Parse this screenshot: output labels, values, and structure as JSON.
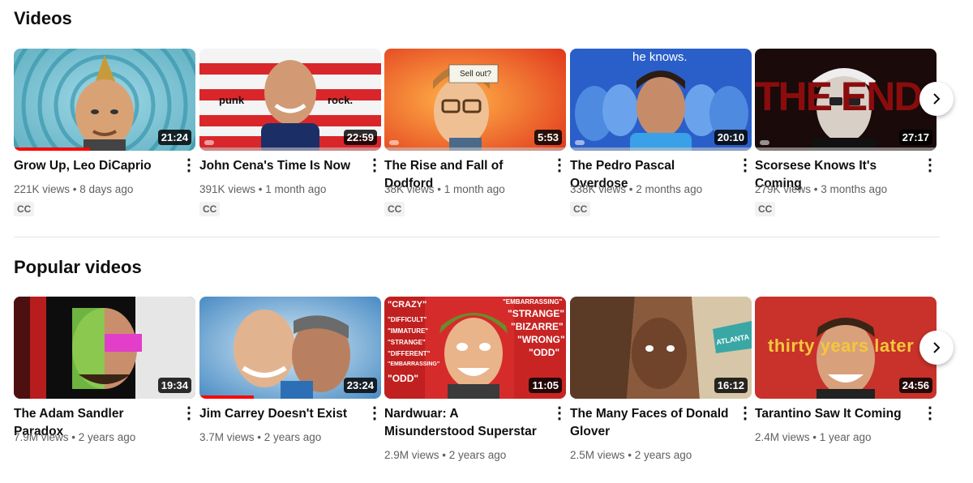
{
  "sections": [
    {
      "title": "Videos",
      "videos": [
        {
          "title": "Grow Up, Leo DiCaprio",
          "duration": "21:24",
          "views": "221K views",
          "age": "8 days ago",
          "cc": "CC",
          "progress": 0.42
        },
        {
          "title": "John Cena's Time Is Now",
          "duration": "22:59",
          "views": "391K views",
          "age": "1 month ago",
          "cc": "CC",
          "thumb_left_text": "punk",
          "thumb_right_text": "rock."
        },
        {
          "title": "The Rise and Fall of Dodford",
          "duration": "5:53",
          "views": "38K views",
          "age": "1 month ago",
          "cc": "CC",
          "thumb_text": "Sell out?"
        },
        {
          "title": "The Pedro Pascal Overdose",
          "duration": "20:10",
          "views": "338K views",
          "age": "2 months ago",
          "cc": "CC",
          "thumb_text": "he knows."
        },
        {
          "title": "Scorsese Knows It's Coming",
          "duration": "27:17",
          "views": "279K views",
          "age": "3 months ago",
          "cc": "CC",
          "thumb_text": "THE END"
        }
      ]
    },
    {
      "title": "Popular videos",
      "videos": [
        {
          "title": "The Adam Sandler Paradox",
          "duration": "19:34",
          "views": "7.9M views",
          "age": "2 years ago"
        },
        {
          "title": "Jim Carrey Doesn't Exist",
          "duration": "23:24",
          "views": "3.7M views",
          "age": "2 years ago",
          "progress": 0.3
        },
        {
          "title": "Nardwuar: A Misunderstood Superstar",
          "duration": "11:05",
          "views": "2.9M views",
          "age": "2 years ago",
          "thumb_words": [
            "\"CRAZY\"",
            "\"EMBARRASSING\"",
            "\"STRANGE\"",
            "\"BIZARRE\"",
            "\"WRONG\"",
            "\"ODD\"",
            "\"DIFFICULT\"",
            "\"IMMATURE\"",
            "\"STRANGE\"",
            "\"DIFFERENT\"",
            "\"EMBARRASSING\"",
            "\"ODD\""
          ]
        },
        {
          "title": "The Many Faces of Donald Glover",
          "duration": "16:12",
          "views": "2.5M views",
          "age": "2 years ago",
          "thumb_text": "ATLANTA"
        },
        {
          "title": "Tarantino Saw It Coming",
          "duration": "24:56",
          "views": "2.4M views",
          "age": "1 year ago",
          "thumb_text": "thirty years later"
        }
      ]
    }
  ],
  "next_icon": "chevron-right-icon",
  "menu_icon": "kebab-menu-icon",
  "colors": {
    "progress": "#ff0000",
    "meta": "#606060",
    "text": "#0f0f0f"
  }
}
